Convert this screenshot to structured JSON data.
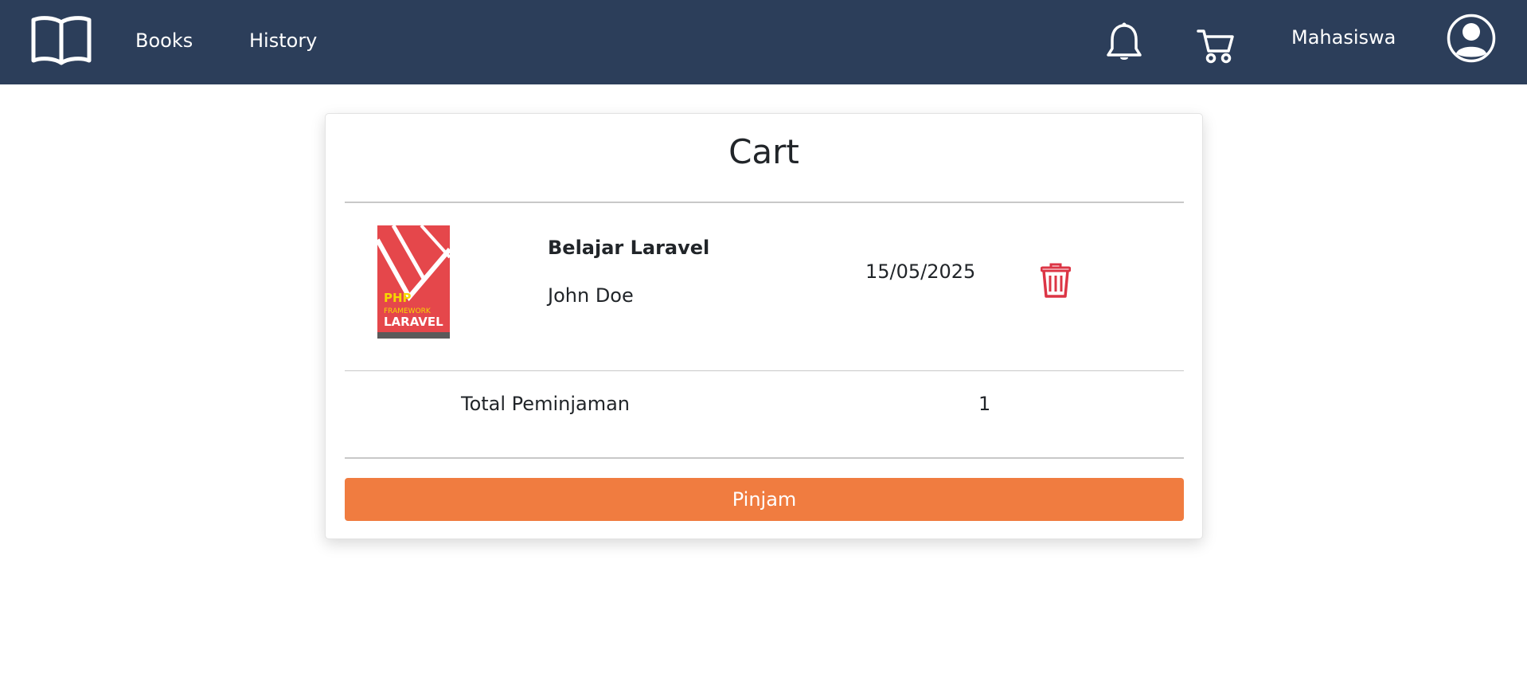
{
  "nav": {
    "logo_icon": "open-book-icon",
    "books_label": "Books",
    "history_label": "History",
    "notification_icon": "bell-icon",
    "cart_icon": "cart-icon",
    "username": "Mahasiswa",
    "avatar_icon": "user-circle-icon",
    "background_color": "#2c3e5a"
  },
  "cart": {
    "title": "Cart",
    "items": [
      {
        "cover_icon": "book-cover-image",
        "cover_text_line1": "PHP",
        "cover_text_line2": "FRAMEWORK",
        "cover_text_line3": "LARAVEL",
        "title": "Belajar Laravel",
        "author": "John Doe",
        "date": "15/05/2025",
        "delete_icon": "trash-icon"
      }
    ],
    "total_label": "Total Peminjaman",
    "total_value": "1",
    "submit_label": "Pinjam",
    "accent_color": "#f07c40",
    "delete_color": "#dc3545"
  }
}
